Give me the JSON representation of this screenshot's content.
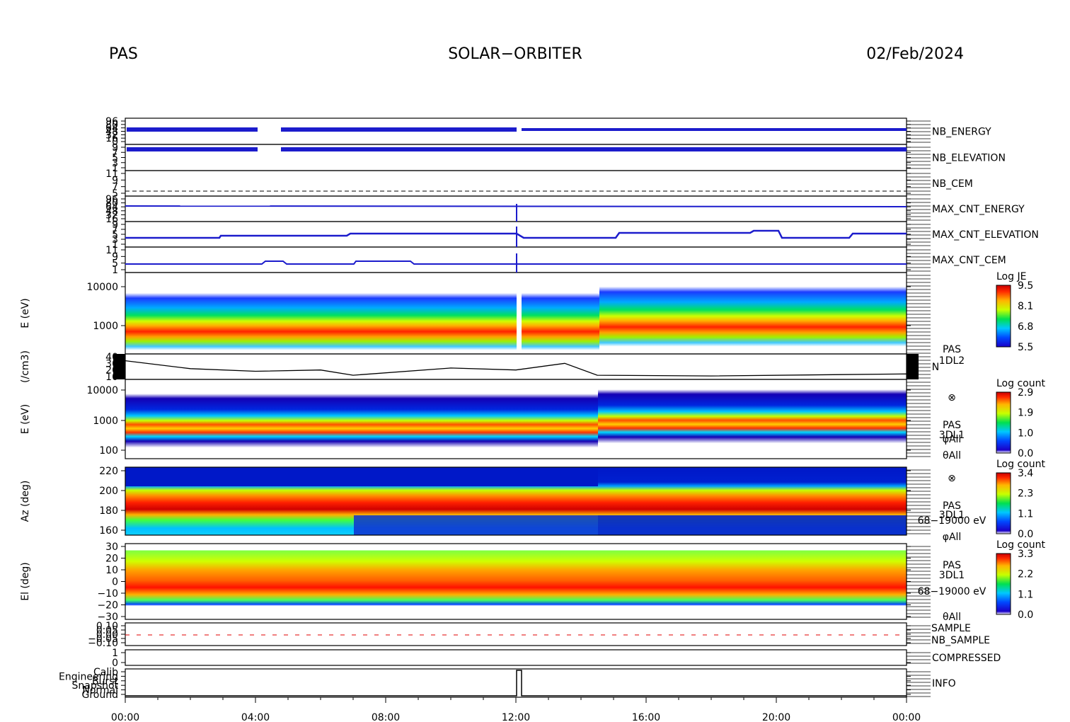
{
  "header": {
    "left": "PAS",
    "center": "SOLAR−ORBITER",
    "right": "02/Feb/2024"
  },
  "colors": {
    "blue": "#1c1ccc",
    "red": "#e00000",
    "black": "#000000"
  },
  "chart_data": {
    "type": "heatmap",
    "x_ticks": [
      "00:00",
      "04:00",
      "08:00",
      "12:00",
      "16:00",
      "20:00",
      "00:00"
    ],
    "panels": [
      {
        "id": "nb_energy",
        "label": "NB_ENERGY",
        "label_color": "blue",
        "ytick_labels": [
          "96",
          "80",
          "64",
          "48",
          "32",
          "16",
          "0"
        ]
      },
      {
        "id": "nb_elevation",
        "label": "NB_ELEVATION",
        "label_color": "blue",
        "ytick_labels": [
          "9",
          "7",
          "5",
          "3",
          "1"
        ]
      },
      {
        "id": "nb_cem",
        "label": "NB_CEM",
        "label_color": "blue",
        "ytick_labels": [
          "11",
          "9",
          "7",
          "5"
        ]
      },
      {
        "id": "max_cnt_energy",
        "label": "MAX_CNT_ENERGY",
        "label_color": "blue",
        "ytick_labels": [
          "96",
          "80",
          "64",
          "48",
          "32",
          "16"
        ]
      },
      {
        "id": "max_cnt_elevation",
        "label": "MAX_CNT_ELEVATION",
        "label_color": "blue",
        "ytick_labels": [
          "9",
          "7",
          "5",
          "3",
          "1"
        ]
      },
      {
        "id": "max_cnt_cem",
        "label": "MAX_CNT_CEM",
        "label_color": "blue",
        "ytick_labels": [
          "11",
          "9",
          "5",
          "1"
        ]
      },
      {
        "id": "je",
        "ylabel": "E (eV)",
        "ytick_labels": [
          "10000",
          "1000"
        ],
        "colorbar": {
          "title": "Log JE",
          "ticks": [
            "9.5",
            "8.1",
            "6.8",
            "5.5"
          ]
        }
      },
      {
        "id": "density",
        "ylabel": "(/cm3)",
        "ytick_labels": [
          "40",
          "30",
          "20",
          "10"
        ],
        "right_labels": [
          "PAS",
          "1DL2",
          "N"
        ]
      },
      {
        "id": "counts_e",
        "ylabel": "E (eV)",
        "ytick_labels": [
          "10000",
          "1000",
          "100"
        ],
        "right_labels": [
          "⊗",
          "PAS",
          "3DL1",
          "φAll",
          "θAll"
        ],
        "colorbar": {
          "title": "Log count",
          "ticks": [
            "2.9",
            "1.9",
            "1.0",
            "0.0"
          ]
        }
      },
      {
        "id": "counts_az",
        "ylabel": "Az (deg)",
        "ytick_labels": [
          "220",
          "200",
          "180",
          "160"
        ],
        "right_labels": [
          "⊗",
          "PAS",
          "3DL1",
          "68−19000 eV",
          "φAll"
        ],
        "colorbar": {
          "title": "Log count",
          "ticks": [
            "3.4",
            "2.3",
            "1.1",
            "0.0"
          ]
        }
      },
      {
        "id": "counts_el",
        "ylabel": "El (deg)",
        "ytick_labels": [
          "30",
          "20",
          "10",
          "0",
          "−10",
          "−20",
          "−30"
        ],
        "right_labels": [
          "PAS",
          "3DL1",
          "68−19000 eV",
          "θAll"
        ],
        "colorbar": {
          "title": "Log count",
          "ticks": [
            "3.3",
            "2.2",
            "1.1",
            "0.0"
          ]
        }
      },
      {
        "id": "sample",
        "labels": [
          "SAMPLE",
          "NB_SAMPLE"
        ],
        "label_colors": [
          "blue",
          "red"
        ],
        "ytick_labels": [
          "0.10",
          "0.05",
          "0.00",
          "−0.05",
          "−0.10"
        ]
      },
      {
        "id": "compressed",
        "label": "COMPRESSED",
        "label_color": "blue",
        "ytick_labels": [
          "1",
          "0"
        ]
      },
      {
        "id": "info",
        "label": "INFO",
        "label_color": "black",
        "ytick_labels": [
          "Calib",
          "Engineering",
          "Burst",
          "Snapshot",
          "Normal",
          "Ground"
        ]
      }
    ],
    "density_series": {
      "name": "N",
      "unit": "/cm3",
      "x_hours": [
        0,
        2,
        4,
        6,
        7,
        10,
        12,
        13.5,
        14.5,
        18,
        22,
        24
      ],
      "y": [
        34,
        22,
        18,
        20,
        12,
        23,
        20,
        30,
        12,
        11,
        13,
        14
      ]
    }
  }
}
